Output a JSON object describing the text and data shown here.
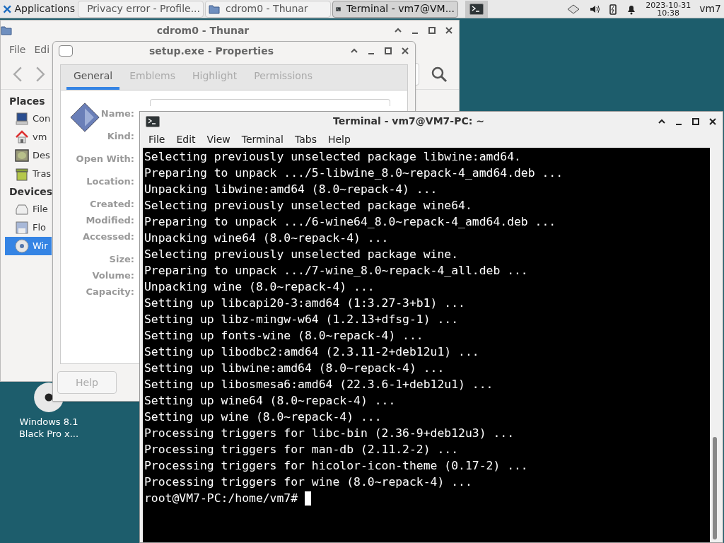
{
  "panel": {
    "menu_label": "Applications",
    "tasks": [
      {
        "label": "Privacy error - Profile...",
        "kind": "browser",
        "selected": false
      },
      {
        "label": "cdrom0 - Thunar",
        "kind": "folder",
        "selected": false
      },
      {
        "label": "Terminal - vm7@VM...",
        "kind": "terminal",
        "selected": true
      }
    ],
    "date": "2023-10-31",
    "time": "10:38",
    "user": "vm7"
  },
  "desktop_icon": {
    "label_lines": [
      "Windows 8.1",
      "Black Pro x..."
    ]
  },
  "file_manager": {
    "title": "cdrom0 - Thunar",
    "menu": [
      "File",
      "Edi"
    ],
    "sections": [
      {
        "title": "Places",
        "items": [
          {
            "label": "Con",
            "kind": "computer",
            "selected": false
          },
          {
            "label": "vm",
            "kind": "home",
            "selected": false
          },
          {
            "label": "Des",
            "kind": "desktop",
            "selected": false
          },
          {
            "label": "Tras",
            "kind": "trash",
            "selected": false
          }
        ]
      },
      {
        "title": "Devices",
        "items": [
          {
            "label": "File",
            "kind": "drive",
            "selected": false
          },
          {
            "label": "Flo",
            "kind": "floppy",
            "selected": false
          },
          {
            "label": "Wir",
            "kind": "disc",
            "selected": true
          }
        ]
      }
    ]
  },
  "properties": {
    "title": "setup.exe - Properties",
    "tabs": [
      {
        "label": "General",
        "selected": true
      },
      {
        "label": "Emblems",
        "selected": false
      },
      {
        "label": "Highlight",
        "selected": false
      },
      {
        "label": "Permissions",
        "selected": false
      }
    ],
    "field_groups": [
      [
        "Name:"
      ],
      [
        "Kind:"
      ],
      [
        "Open With:"
      ],
      [
        "Location:"
      ],
      [
        "Created:",
        "Modified:",
        "Accessed:"
      ],
      [
        "Size:",
        "Volume:",
        "Capacity:"
      ]
    ],
    "help_button": "Help"
  },
  "terminal": {
    "title": "Terminal - vm7@VM7-PC: ~",
    "menu": [
      "File",
      "Edit",
      "View",
      "Terminal",
      "Tabs",
      "Help"
    ],
    "lines": [
      "Selecting previously unselected package libwine:amd64.",
      "Preparing to unpack .../5-libwine_8.0~repack-4_amd64.deb ...",
      "Unpacking libwine:amd64 (8.0~repack-4) ...",
      "Selecting previously unselected package wine64.",
      "Preparing to unpack .../6-wine64_8.0~repack-4_amd64.deb ...",
      "Unpacking wine64 (8.0~repack-4) ...",
      "Selecting previously unselected package wine.",
      "Preparing to unpack .../7-wine_8.0~repack-4_all.deb ...",
      "Unpacking wine (8.0~repack-4) ...",
      "Setting up libcapi20-3:amd64 (1:3.27-3+b1) ...",
      "Setting up libz-mingw-w64 (1.2.13+dfsg-1) ...",
      "Setting up fonts-wine (8.0~repack-4) ...",
      "Setting up libodbc2:amd64 (2.3.11-2+deb12u1) ...",
      "Setting up libwine:amd64 (8.0~repack-4) ...",
      "Setting up libosmesa6:amd64 (22.3.6-1+deb12u1) ...",
      "Setting up wine64 (8.0~repack-4) ...",
      "Setting up wine (8.0~repack-4) ...",
      "Processing triggers for libc-bin (2.36-9+deb12u3) ...",
      "Processing triggers for man-db (2.11.2-2) ...",
      "Processing triggers for hicolor-icon-theme (0.17-2) ...",
      "Processing triggers for wine (8.0~repack-4) ..."
    ],
    "prompt": "root@VM7-PC:/home/vm7#"
  }
}
